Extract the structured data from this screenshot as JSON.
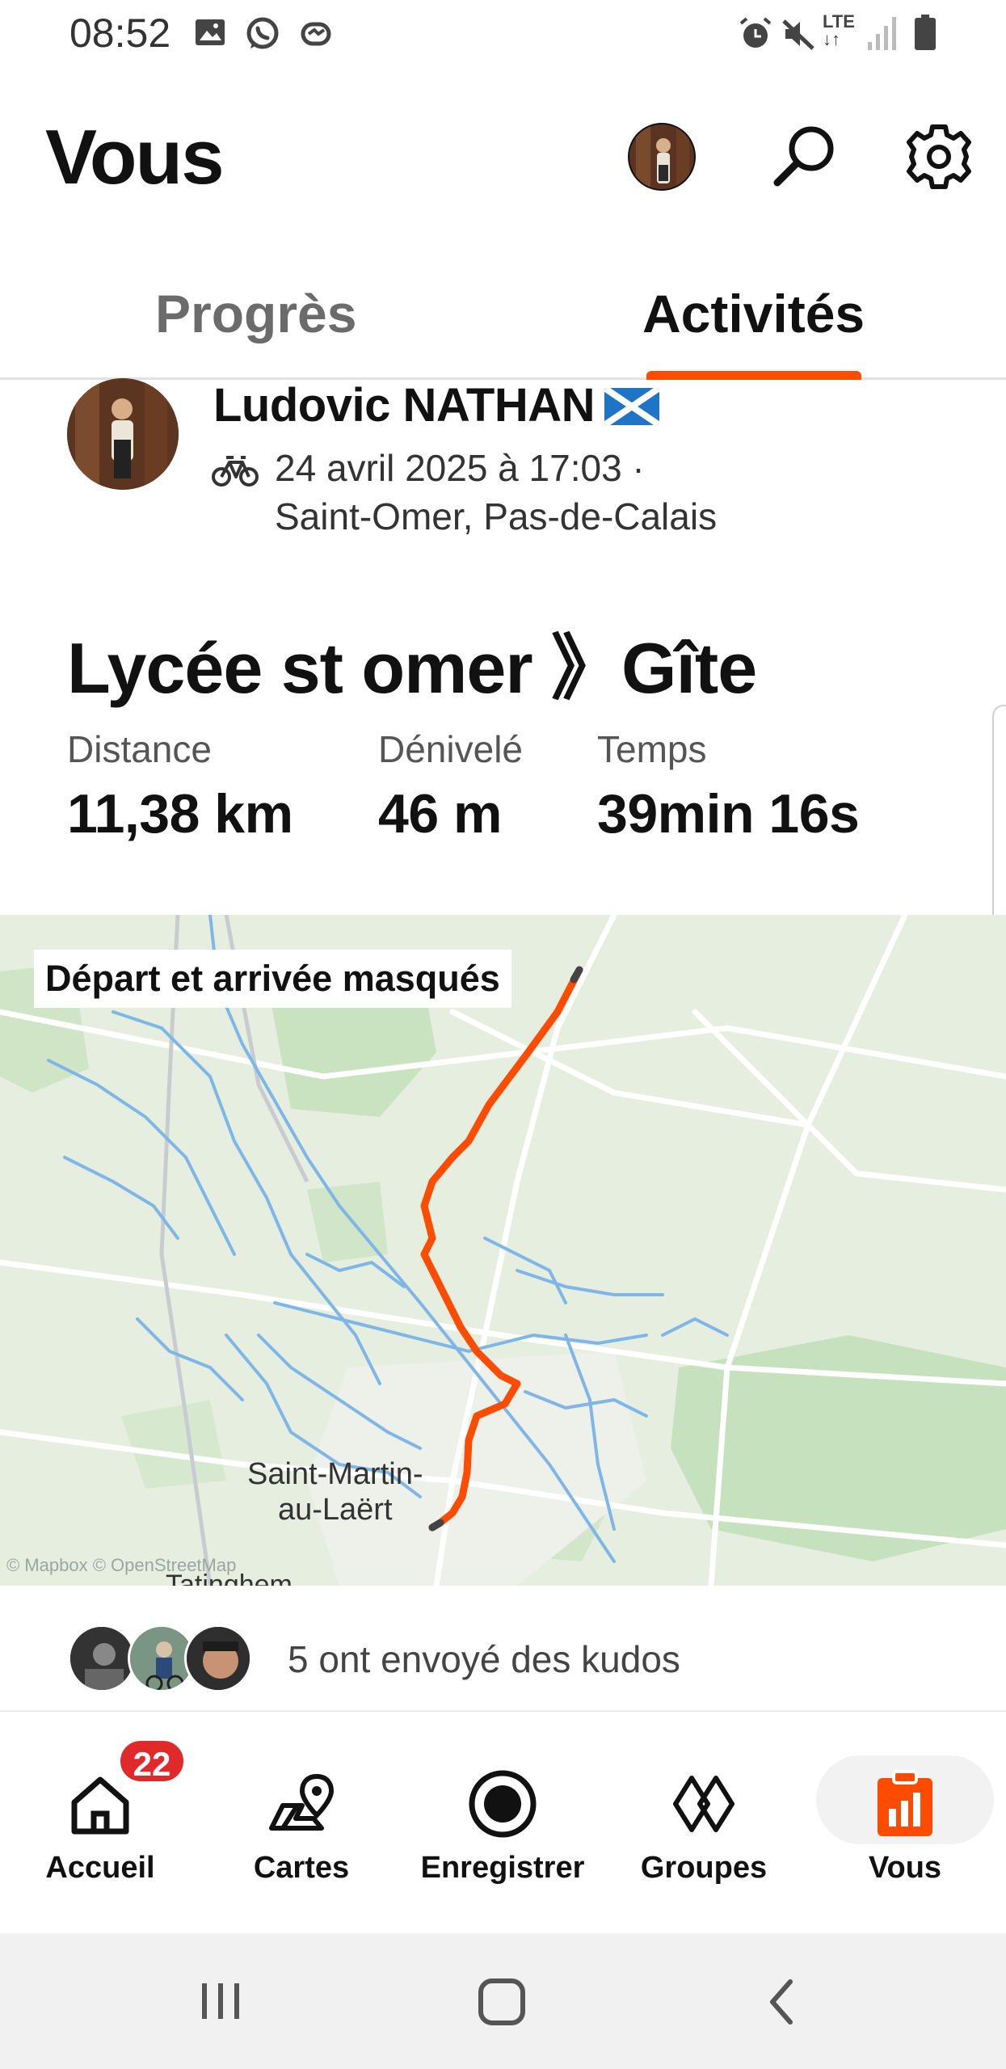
{
  "status_bar": {
    "time": "08:52",
    "left_icons": [
      "gallery-icon",
      "whatsapp-icon",
      "messenger-icon"
    ],
    "right_icons": [
      "alarm-icon",
      "mute-icon",
      "lte-icon",
      "signal-icon",
      "battery-icon"
    ],
    "network": "LTE"
  },
  "header": {
    "title": "Vous",
    "icons": [
      "profile-avatar",
      "search-icon",
      "gear-icon"
    ]
  },
  "tabs": [
    {
      "label": "Progrès",
      "active": false
    },
    {
      "label": "Activités",
      "active": true
    }
  ],
  "activity": {
    "athlete_name": "Ludovic NATHAN",
    "flag": "scotland-flag",
    "sport_icon": "bike-icon",
    "date_line": "24 avril 2025 à 17:03 ·",
    "location": "Saint-Omer, Pas-de-Calais",
    "title": "Lycée st omer 》Gîte",
    "stats": [
      {
        "label": "Distance",
        "value": "11,38 km"
      },
      {
        "label": "Dénivelé",
        "value": "46 m"
      },
      {
        "label": "Temps",
        "value": "39min 16s"
      }
    ],
    "map": {
      "badge": "Départ et arrivée masqués",
      "town_label_1": "Saint-Martin-\nau-Laërt",
      "town_label_2": "Tatinghem",
      "attribution": "© Mapbox © OpenStreetMap",
      "route_color": "#fc4c02"
    },
    "kudos_text": "5 ont envoyé des kudos"
  },
  "bottom_nav": {
    "items": [
      {
        "label": "Accueil",
        "icon": "home-icon",
        "badge": "22"
      },
      {
        "label": "Cartes",
        "icon": "map-icon"
      },
      {
        "label": "Enregistrer",
        "icon": "record-icon"
      },
      {
        "label": "Groupes",
        "icon": "groups-icon"
      },
      {
        "label": "Vous",
        "icon": "you-icon",
        "active": true
      }
    ]
  },
  "system_nav": [
    "recents-icon",
    "home-button-icon",
    "back-icon"
  ],
  "colors": {
    "accent": "#fc4c02",
    "badge": "#e0292b"
  }
}
